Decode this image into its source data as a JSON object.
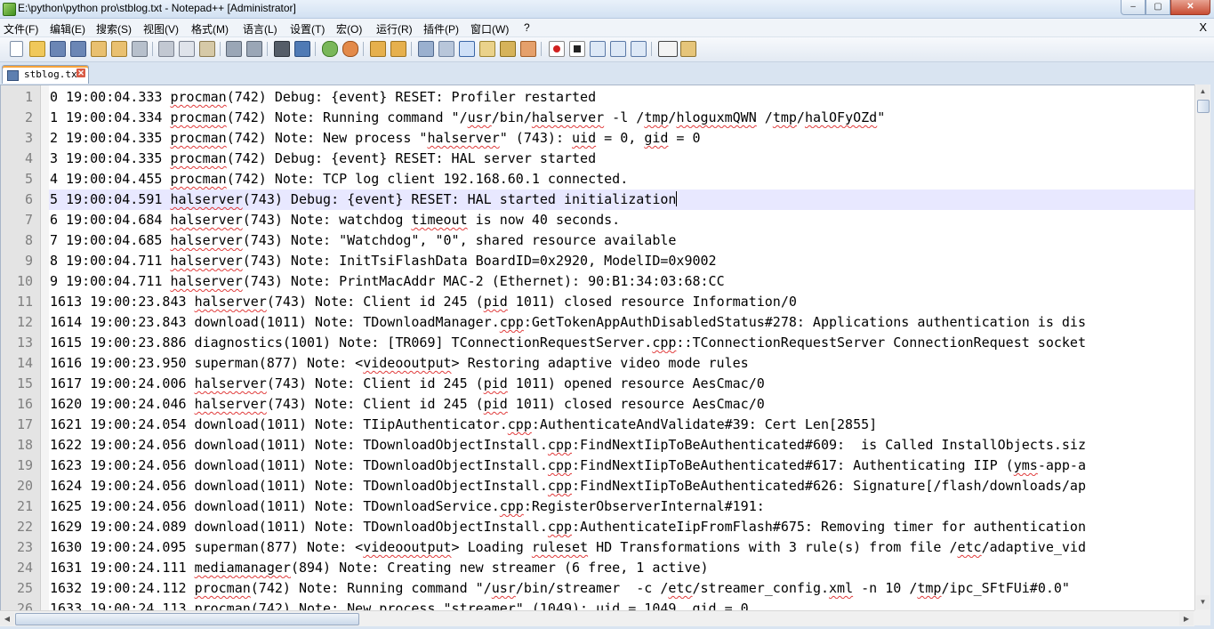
{
  "window": {
    "title": "E:\\python\\python pro\\stblog.txt - Notepad++ [Administrator]",
    "minimize": "–",
    "maximize": "▢",
    "close": "✕"
  },
  "menu": {
    "items": [
      "文件(F)",
      "编辑(E)",
      "搜索(S)",
      "视图(V)",
      "格式(M)",
      "语言(L)",
      "设置(T)",
      "宏(O)",
      "运行(R)",
      "插件(P)",
      "窗口(W)",
      "?"
    ],
    "close_label": "X"
  },
  "toolbar": {
    "icons": [
      "new-file-icon",
      "open-file-icon",
      "save-icon",
      "save-all-icon",
      "close-icon",
      "close-all-icon",
      "print-icon",
      "cut-icon",
      "copy-icon",
      "paste-icon",
      "undo-icon",
      "redo-icon",
      "find-icon",
      "replace-icon",
      "zoom-in-icon",
      "zoom-out-icon",
      "sync-vertical-icon",
      "sync-horizontal-icon",
      "word-wrap-icon",
      "show-all-chars-icon",
      "indent-guide-icon",
      "doc-map-icon",
      "function-list-icon",
      "folder-as-workspace-icon",
      "record-macro-icon",
      "stop-macro-icon",
      "play-macro-icon",
      "run-macro-multiple-icon",
      "save-macro-icon",
      "spell-check-icon",
      "spell-settings-icon"
    ]
  },
  "tabs": [
    {
      "label": "stblog.txt",
      "close": "✕"
    }
  ],
  "editor": {
    "current_line": 6,
    "lines": [
      "0 19:00:04.333 procman(742) Debug: {event} RESET: Profiler restarted",
      "1 19:00:04.334 procman(742) Note: Running command \"/usr/bin/halserver -l /tmp/hloguxmQWN /tmp/halOFyOZd\"",
      "2 19:00:04.335 procman(742) Note: New process \"halserver\" (743): uid = 0, gid = 0",
      "3 19:00:04.335 procman(742) Debug: {event} RESET: HAL server started",
      "4 19:00:04.455 procman(742) Note: TCP log client 192.168.60.1 connected.",
      "5 19:00:04.591 halserver(743) Debug: {event} RESET: HAL started initialization",
      "6 19:00:04.684 halserver(743) Note: watchdog timeout is now 40 seconds.",
      "7 19:00:04.685 halserver(743) Note: \"Watchdog\", \"0\", shared resource available",
      "8 19:00:04.711 halserver(743) Note: InitTsiFlashData BoardID=0x2920, ModelID=0x9002",
      "9 19:00:04.711 halserver(743) Note: PrintMacAddr MAC-2 (Ethernet): 90:B1:34:03:68:CC",
      "1613 19:00:23.843 halserver(743) Note: Client id 245 (pid 1011) closed resource Information/0",
      "1614 19:00:23.843 download(1011) Note: TDownloadManager.cpp:GetTokenAppAuthDisabledStatus#278: Applications authentication is dis",
      "1615 19:00:23.886 diagnostics(1001) Note: [TR069] TConnectionRequestServer.cpp::TConnectionRequestServer ConnectionRequest socket",
      "1616 19:00:23.950 superman(877) Note: <videooutput> Restoring adaptive video mode rules",
      "1617 19:00:24.006 halserver(743) Note: Client id 245 (pid 1011) opened resource AesCmac/0",
      "1620 19:00:24.046 halserver(743) Note: Client id 245 (pid 1011) closed resource AesCmac/0",
      "1621 19:00:24.054 download(1011) Note: TIipAuthenticator.cpp:AuthenticateAndValidate#39: Cert Len[2855]",
      "1622 19:00:24.056 download(1011) Note: TDownloadObjectInstall.cpp:FindNextIipToBeAuthenticated#609:  is Called InstallObjects.siz",
      "1623 19:00:24.056 download(1011) Note: TDownloadObjectInstall.cpp:FindNextIipToBeAuthenticated#617: Authenticating IIP (yms-app-a",
      "1624 19:00:24.056 download(1011) Note: TDownloadObjectInstall.cpp:FindNextIipToBeAuthenticated#626: Signature[/flash/downloads/ap",
      "1625 19:00:24.056 download(1011) Note: TDownloadService.cpp:RegisterObserverInternal#191:",
      "1629 19:00:24.089 download(1011) Note: TDownloadObjectInstall.cpp:AuthenticateIipFromFlash#675: Removing timer for authentication",
      "1630 19:00:24.095 superman(877) Note: <videooutput> Loading ruleset HD Transformations with 3 rule(s) from file /etc/adaptive_vid",
      "1631 19:00:24.111 mediamanager(894) Note: Creating new streamer (6 free, 1 active)",
      "1632 19:00:24.112 procman(742) Note: Running command \"/usr/bin/streamer  -c /etc/streamer_config.xml -n 10 /tmp/ipc_SFtFUi#0.0\"",
      "1633 19:00:24.113 procman(742) Note: New process \"streamer\" (1049): uid = 1049, gid = 0"
    ]
  },
  "scrollbars": {
    "up": "▲",
    "down": "▼",
    "left": "◀",
    "right": "▶"
  },
  "colors": {
    "current_line_bg": "#e8e8ff",
    "gutter_bg": "#e4e4e4",
    "line_number": "#7f7f7f",
    "spell_error": "#e03a3a"
  }
}
